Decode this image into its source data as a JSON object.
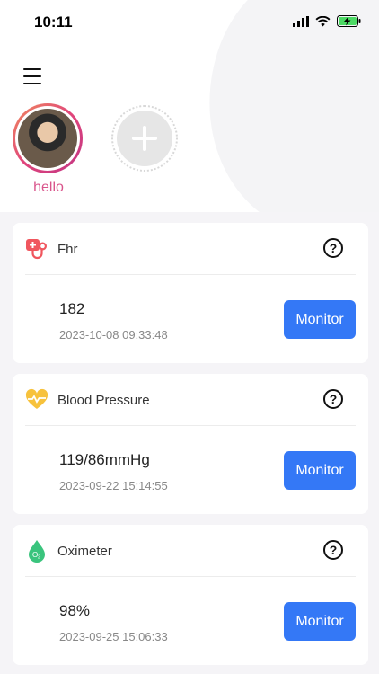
{
  "status_bar": {
    "time": "10:11"
  },
  "profiles": [
    {
      "name": "hello"
    }
  ],
  "cards": [
    {
      "title": "Fhr",
      "icon": "stethoscope-icon",
      "icon_color": "#f0565e",
      "reading": "182",
      "timestamp": "2023-10-08 09:33:48",
      "button": "Monitor"
    },
    {
      "title": "Blood Pressure",
      "icon": "heart-pulse-icon",
      "icon_color": "#f7c23c",
      "reading": "119/86mmHg",
      "timestamp": "2023-09-22 15:14:55",
      "button": "Monitor"
    },
    {
      "title": "Oximeter",
      "icon": "oxygen-drop-icon",
      "icon_color": "#3ac47d",
      "reading": "98%",
      "timestamp": "2023-09-25 15:06:33",
      "button": "Monitor"
    }
  ],
  "colors": {
    "accent": "#3478f6",
    "profile_name": "#d9548b",
    "background_list": "#f5f4f7"
  }
}
